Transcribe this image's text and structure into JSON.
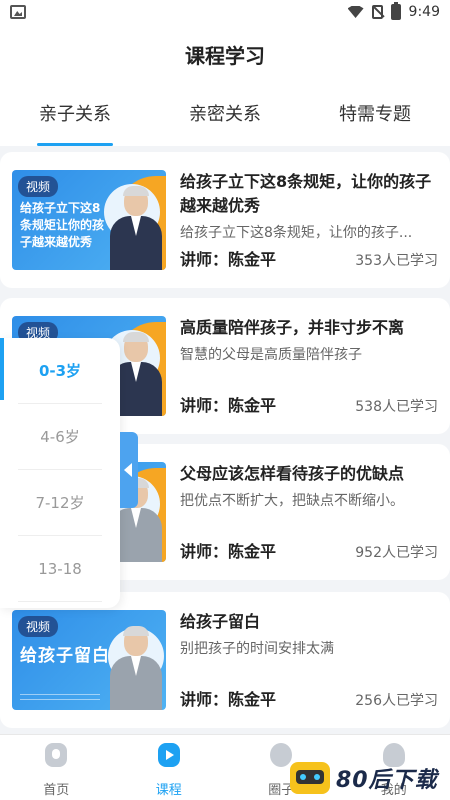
{
  "status_bar": {
    "time": "9:49"
  },
  "header": {
    "title": "课程学习",
    "tabs": [
      {
        "label": "亲子关系",
        "active": true
      },
      {
        "label": "亲密关系",
        "active": false
      },
      {
        "label": "特需专题",
        "active": false
      }
    ]
  },
  "courses": [
    {
      "badge": "视频",
      "thumb_caption": "给孩子立下这8条规矩让你的孩子越来越优秀",
      "title": "给孩子立下这8条规矩，让你的孩子越来越优秀",
      "desc": "给孩子立下这8条规矩，让你的孩子...",
      "teacher": "讲师：陈金平",
      "count": "353人已学习"
    },
    {
      "badge": "视频",
      "thumb_caption": "",
      "title": "高质量陪伴孩子，并非寸步不离",
      "desc": "智慧的父母是高质量陪伴孩子",
      "teacher": "讲师：陈金平",
      "count": "538人已学习"
    },
    {
      "badge": "",
      "thumb_caption": "",
      "title": "父母应该怎样看待孩子的优缺点",
      "desc": "把优点不断扩大，把缺点不断缩小。",
      "teacher": "讲师：陈金平",
      "count": "952人已学习"
    },
    {
      "badge": "视频",
      "thumb_caption": "给孩子留白",
      "title": "给孩子留白",
      "desc": "别把孩子的时间安排太满",
      "teacher": "讲师：陈金平",
      "count": "256人已学习"
    }
  ],
  "age_filter": {
    "items": [
      "0-3岁",
      "4-6岁",
      "7-12岁",
      "13-18"
    ],
    "selected": "0-3岁"
  },
  "bottom_nav": [
    {
      "label": "首页",
      "icon": "home-icon",
      "active": false
    },
    {
      "label": "课程",
      "icon": "course-icon",
      "active": true
    },
    {
      "label": "圈子",
      "icon": "circle-icon",
      "active": false
    },
    {
      "label": "我的",
      "icon": "profile-icon",
      "active": false
    }
  ],
  "watermark": {
    "text": "80后下载"
  },
  "colors": {
    "accent": "#1da1f2",
    "orange": "#f6a623"
  }
}
